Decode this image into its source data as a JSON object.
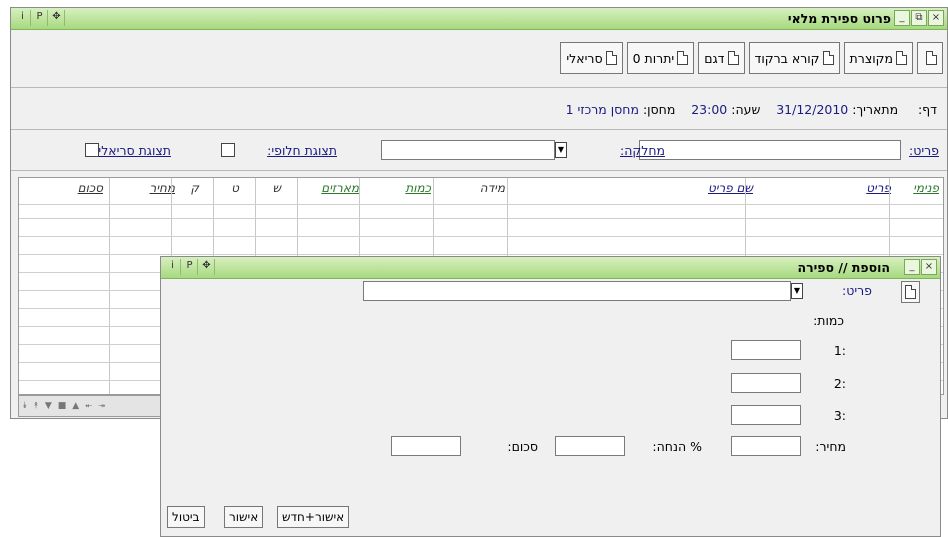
{
  "main_window": {
    "title": "פרוט ספירת מלאי",
    "title_buttons": [
      "i",
      "P",
      "✥"
    ],
    "win_buttons": [
      "×",
      "⧉",
      "_"
    ]
  },
  "toolbar": {
    "compact_label": "מקוצרת",
    "barcode_label": "קורא ברקוד",
    "sample_label": "דגם",
    "balances_label": "יתרות 0",
    "serial_label": "סריאלי"
  },
  "info": {
    "page_label": "דף:",
    "from_date_label": "מתאריך:",
    "from_date_value": "31/12/2010",
    "time_label": "שעה:",
    "time_value": "23:00",
    "warehouse_label": "מחסן:",
    "warehouse_value": "מחסן מרכזי 1"
  },
  "filters": {
    "item_label": "פריט:",
    "department_label": "מחלקה:",
    "alt_display_label": "תצוגת חלופי:",
    "serial_display_label": "תצוגת סריאלי:"
  },
  "grid": {
    "columns": {
      "internal": "פנימי",
      "item": "פריט",
      "item_name": "שם פריט",
      "size": "מידה",
      "quantity": "כמות",
      "packages": "מארזים",
      "s": "ש",
      "t": "ט",
      "k": "ק",
      "price": "מחיר",
      "total": "סכום"
    },
    "nav_icons": [
      "⯯",
      "⯭",
      "▼",
      "■",
      "▲",
      "⯬",
      "⯮"
    ]
  },
  "modal": {
    "title": "הוספת // ספירה",
    "title_buttons": [
      "i",
      "P",
      "✥"
    ],
    "win_buttons": [
      "×",
      "_"
    ],
    "item_label": "פריט:",
    "quantity_label": "כמות:",
    "q1_label": ":1",
    "q2_label": ":2",
    "q3_label": ":3",
    "price_label": "מחיר:",
    "discount_label": "% הנחה:",
    "total_label": "סכום:",
    "confirm_new_label": "אישור+חדש",
    "confirm_label": "אישור",
    "cancel_label": "ביטול"
  }
}
